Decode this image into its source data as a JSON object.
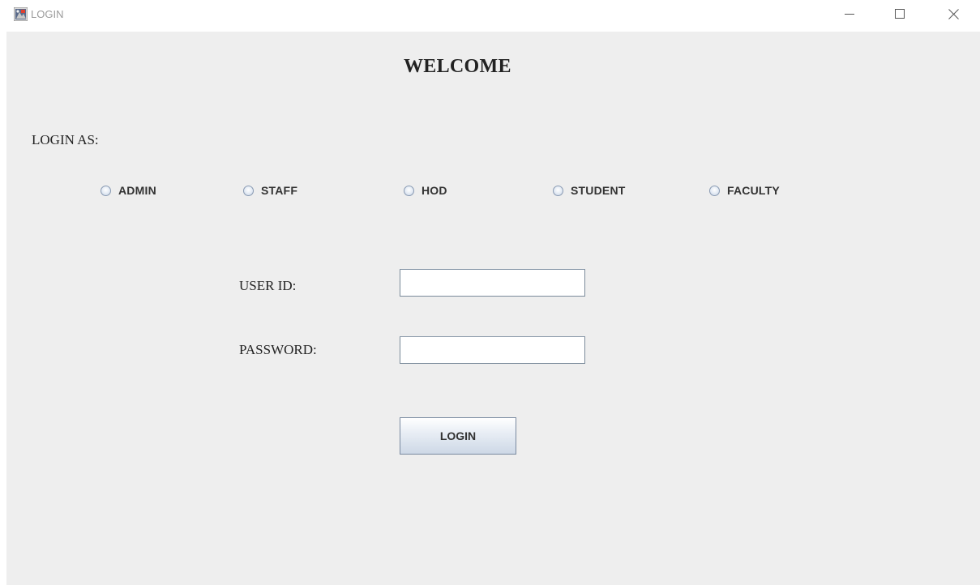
{
  "window": {
    "title": "LOGIN"
  },
  "header": {
    "welcome": "WELCOME"
  },
  "login_as": {
    "label": "LOGIN AS:",
    "options": [
      {
        "label": "ADMIN",
        "checked": false
      },
      {
        "label": "STAFF",
        "checked": false
      },
      {
        "label": "HOD",
        "checked": false
      },
      {
        "label": "STUDENT",
        "checked": false
      },
      {
        "label": "FACULTY",
        "checked": false
      }
    ]
  },
  "form": {
    "user_id_label": "USER ID:",
    "user_id_value": "",
    "password_label": "PASSWORD:",
    "password_value": "",
    "login_button": "LOGIN"
  },
  "icons": {
    "app": "java-app-icon",
    "minimize": "minimize-icon",
    "maximize": "maximize-icon",
    "close": "close-icon"
  },
  "colors": {
    "panel_bg": "#eeeeee",
    "titlebar_bg": "#ffffff",
    "title_text": "#9a9a9a"
  }
}
